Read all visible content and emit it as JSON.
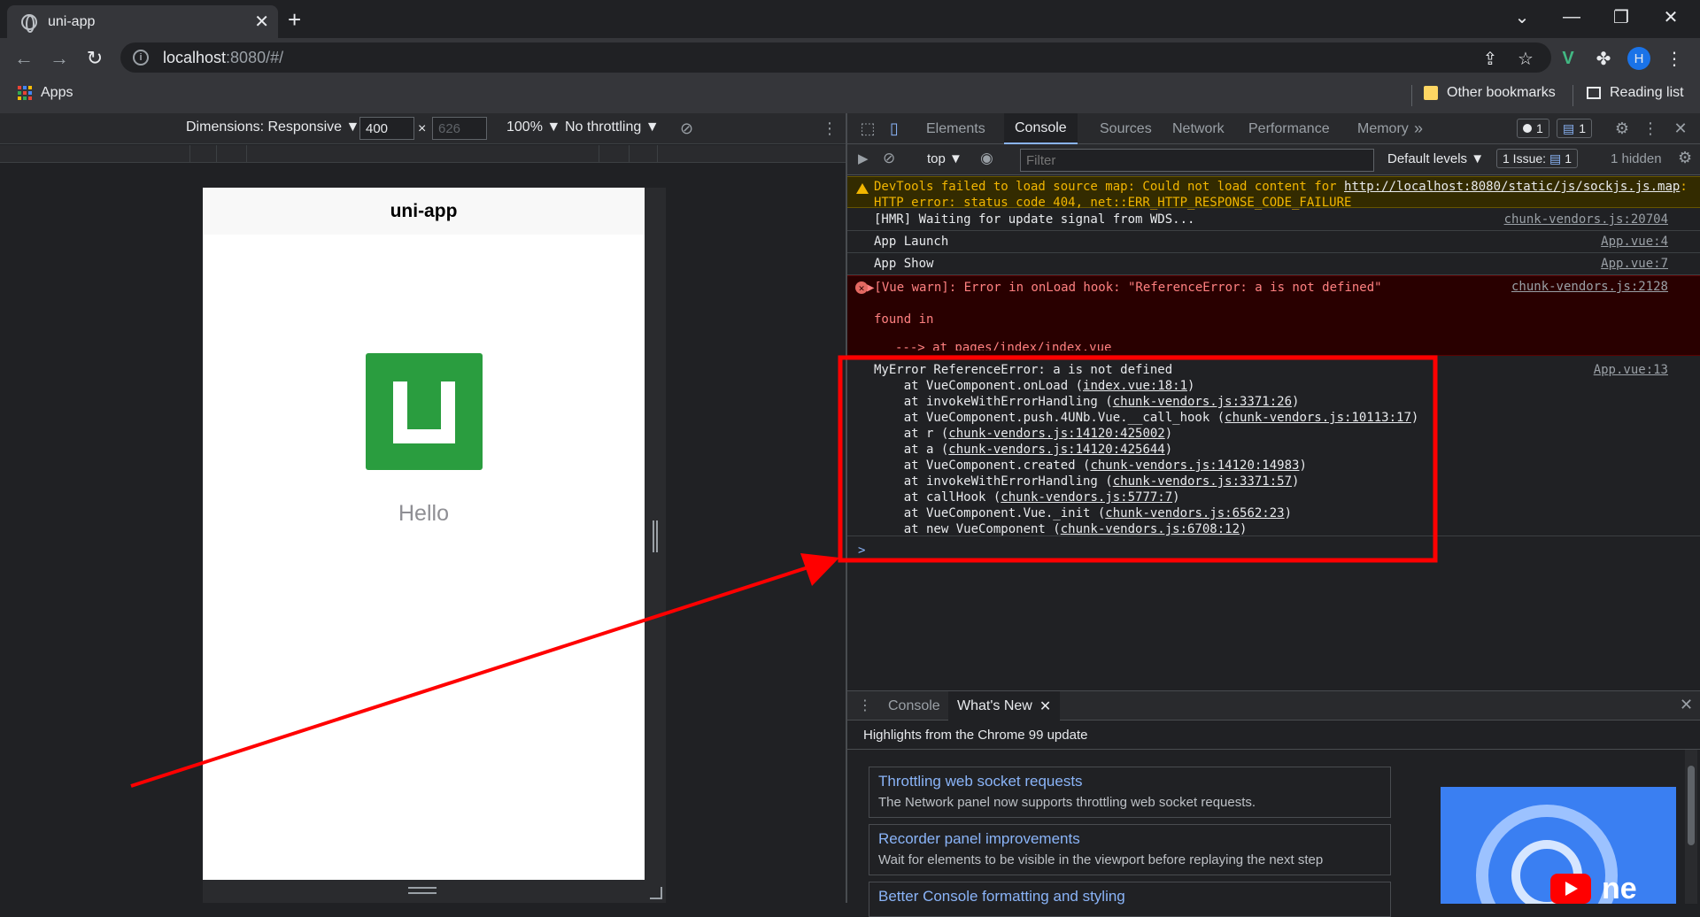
{
  "browser": {
    "tab_title": "uni-app",
    "new_tab": "+",
    "url_host": "localhost",
    "url_path": ":8080/#/",
    "bookmarks": {
      "apps": "Apps",
      "other": "Other bookmarks",
      "reading": "Reading list"
    },
    "profile_initial": "H"
  },
  "device_toolbar": {
    "dimensions": "Dimensions: Responsive ▼",
    "width": "400",
    "height": "626",
    "times": "×",
    "zoom": "100% ▼",
    "throttling": "No throttling ▼"
  },
  "phone": {
    "nav_title": "uni-app",
    "greeting": "Hello"
  },
  "devtools": {
    "tabs": [
      "Elements",
      "Console",
      "Sources",
      "Network",
      "Performance",
      "Memory"
    ],
    "more": "»",
    "badge_errors": "1",
    "badge_messages": "1",
    "context": "top ▼",
    "filter_placeholder": "Filter",
    "levels": "Default levels ▼",
    "issues": "1 Issue:",
    "issues_count": "1",
    "hidden": "1 hidden"
  },
  "console": {
    "warn_line1": "DevTools failed to load source map: Could not load content for ",
    "warn_link": "http://localhost:8080/static/js/sockjs.js.map",
    "warn_tail": ":",
    "warn_line2": "HTTP error: status code 404, net::ERR_HTTP_RESPONSE_CODE_FAILURE",
    "hmr": "[HMR] Waiting for update signal from WDS...",
    "hmr_src": "chunk-vendors.js:20704",
    "launch": "App Launch",
    "launch_src": "App.vue:4",
    "show": "App Show",
    "show_src": "App.vue:7",
    "vue_warn": "▶[Vue warn]: Error in onLoad hook: \"ReferenceError: a is not defined\"",
    "vue_warn_src": "chunk-vendors.js:2128",
    "found_in": "found in",
    "found_path": "---> at pages/index/index.vue",
    "myerror_src": "App.vue:13",
    "myerror_head": "MyError ReferenceError: a is not defined",
    "stack": [
      {
        "pre": "    at VueComponent.onLoad (",
        "link": "index.vue:18:1",
        "post": ")"
      },
      {
        "pre": "    at invokeWithErrorHandling (",
        "link": "chunk-vendors.js:3371:26",
        "post": ")"
      },
      {
        "pre": "    at VueComponent.push.4UNb.Vue.__call_hook (",
        "link": "chunk-vendors.js:10113:17",
        "post": ")"
      },
      {
        "pre": "    at r (",
        "link": "chunk-vendors.js:14120:425002",
        "post": ")"
      },
      {
        "pre": "    at a (",
        "link": "chunk-vendors.js:14120:425644",
        "post": ")"
      },
      {
        "pre": "    at VueComponent.created (",
        "link": "chunk-vendors.js:14120:14983",
        "post": ")"
      },
      {
        "pre": "    at invokeWithErrorHandling (",
        "link": "chunk-vendors.js:3371:57",
        "post": ")"
      },
      {
        "pre": "    at callHook (",
        "link": "chunk-vendors.js:5777:7",
        "post": ")"
      },
      {
        "pre": "    at VueComponent.Vue._init (",
        "link": "chunk-vendors.js:6562:23",
        "post": ")"
      },
      {
        "pre": "    at new VueComponent (",
        "link": "chunk-vendors.js:6708:12",
        "post": ")"
      }
    ],
    "prompt": ">"
  },
  "drawer": {
    "tab_console": "Console",
    "tab_whatsnew": "What's New",
    "heading": "Highlights from the Chrome 99 update",
    "cards": [
      {
        "title": "Throttling web socket requests",
        "desc": "The Network panel now supports throttling web socket requests."
      },
      {
        "title": "Recorder panel improvements",
        "desc": "Wait for elements to be visible in the viewport before replaying the next step"
      },
      {
        "title": "Better Console formatting and styling",
        "desc": ""
      }
    ],
    "promo_text": "ne"
  },
  "colors": {
    "highlight": "#ff0000",
    "logo_green": "#2a9d3f",
    "link_blue": "#8ab4f8"
  }
}
